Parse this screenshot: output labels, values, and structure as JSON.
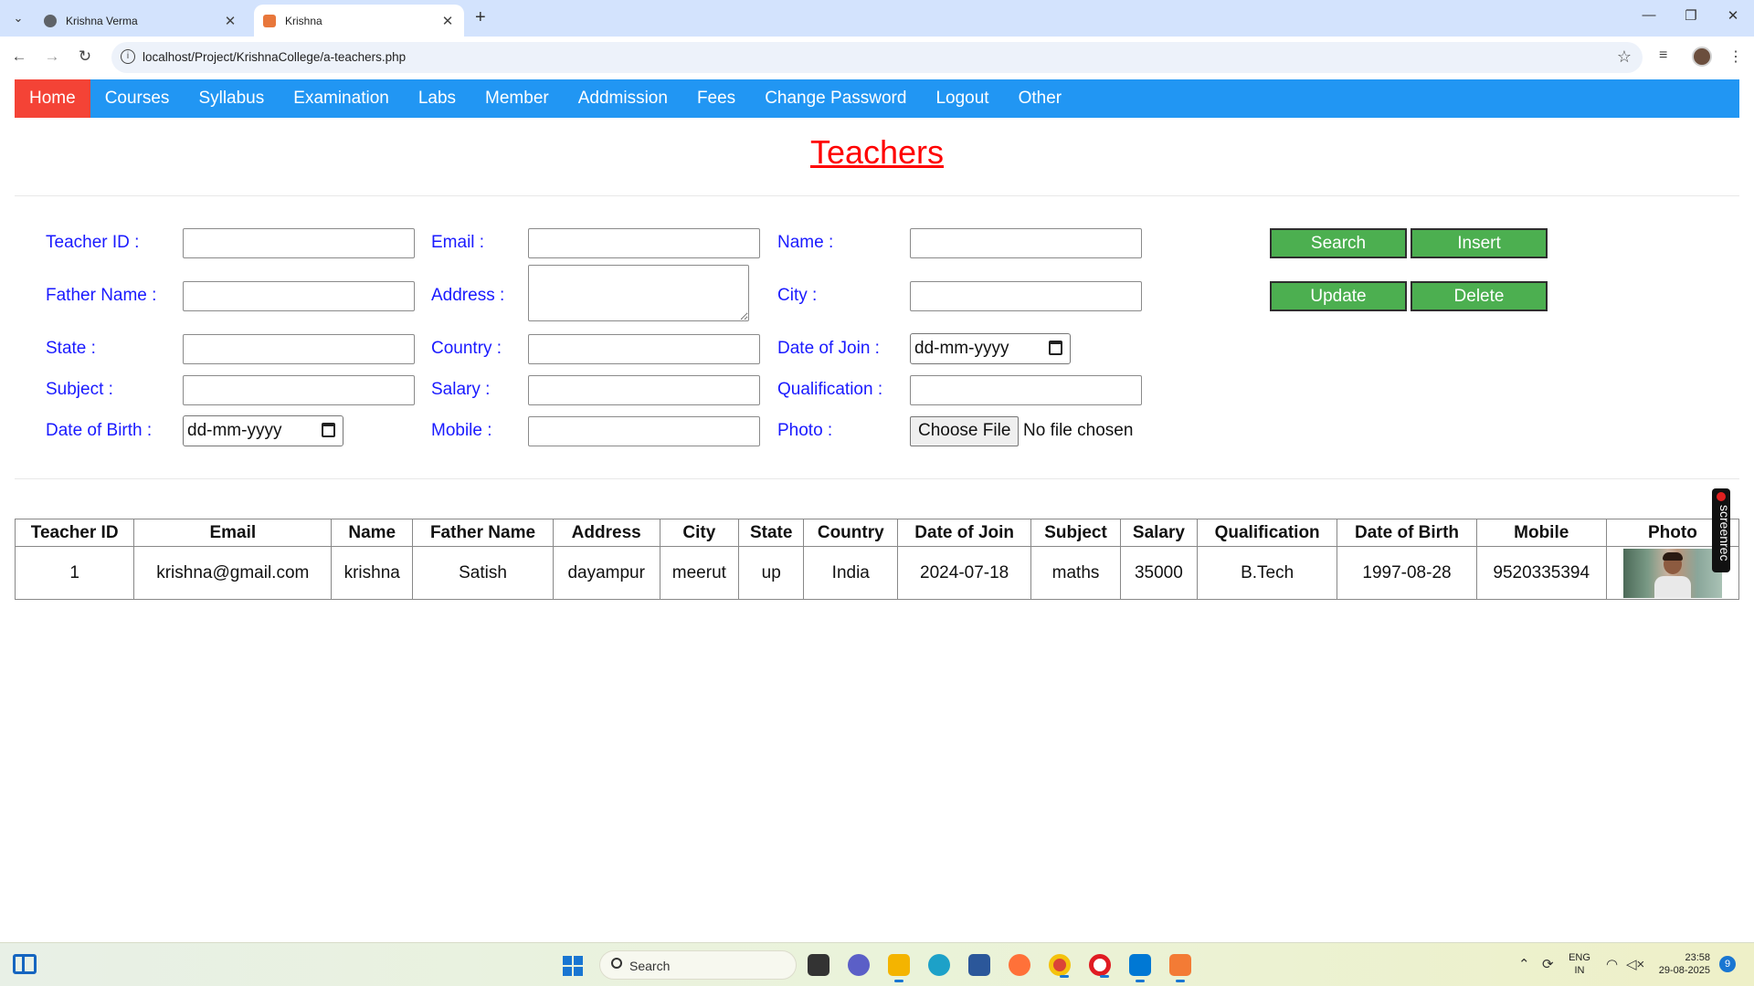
{
  "browser": {
    "tabs": [
      {
        "title": "Krishna Verma",
        "favicon": "globe-icon"
      },
      {
        "title": "Krishna",
        "favicon": "xampp-icon",
        "active": true
      }
    ],
    "url": "localhost/Project/KrishnaCollege/a-teachers.php"
  },
  "nav": {
    "items": [
      "Home",
      "Courses",
      "Syllabus",
      "Examination",
      "Labs",
      "Member",
      "Addmission",
      "Fees",
      "Change Password",
      "Logout",
      "Other"
    ],
    "active": "Home",
    "bg_color": "#2196f3",
    "active_color": "#f44336"
  },
  "page": {
    "title": "Teachers"
  },
  "form": {
    "labels": {
      "teacher_id": "Teacher ID :",
      "email": "Email :",
      "name": "Name :",
      "father_name": "Father Name :",
      "address": "Address :",
      "city": "City :",
      "state": "State :",
      "country": "Country :",
      "date_of_join": "Date of Join :",
      "subject": "Subject :",
      "salary": "Salary :",
      "qualification": "Qualification :",
      "date_of_birth": "Date of Birth :",
      "mobile": "Mobile :",
      "photo": "Photo :"
    },
    "date_placeholder": "dd-mm-yyyy",
    "file_button": "Choose File",
    "file_status": "No file chosen",
    "buttons": {
      "search": "Search",
      "insert": "Insert",
      "update": "Update",
      "delete": "Delete"
    },
    "button_color": "#4caf50",
    "label_color": "#1a1aff"
  },
  "table": {
    "headers": [
      "Teacher ID",
      "Email",
      "Name",
      "Father Name",
      "Address",
      "City",
      "State",
      "Country",
      "Date of Join",
      "Subject",
      "Salary",
      "Qualification",
      "Date of Birth",
      "Mobile",
      "Photo"
    ],
    "rows": [
      [
        "1",
        "krishna@gmail.com",
        "krishna",
        "Satish",
        "dayampur",
        "meerut",
        "up",
        "India",
        "2024-07-18",
        "maths",
        "35000",
        "B.Tech",
        "1997-08-28",
        "9520335394"
      ]
    ]
  },
  "overlay": {
    "screenrec_label": "screenrec"
  },
  "taskbar": {
    "search_label": "Search",
    "lang_top": "ENG",
    "lang_bottom": "IN",
    "time": "23:58",
    "date": "29-08-2025",
    "notifications": "9"
  }
}
